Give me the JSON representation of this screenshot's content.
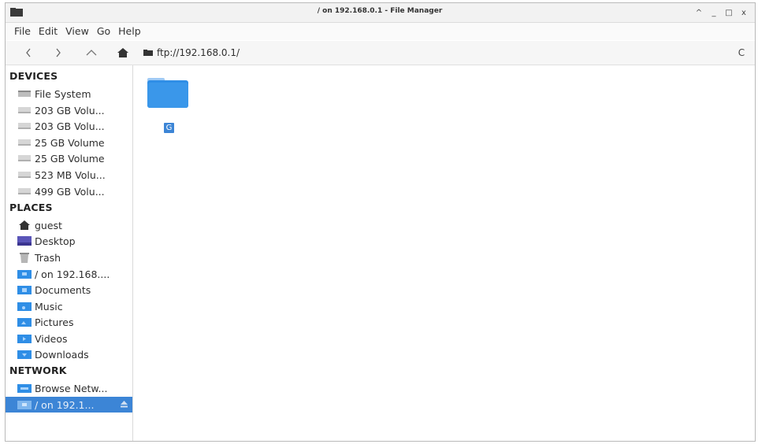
{
  "window": {
    "title": "/ on 192.168.0.1 - File Manager",
    "controls": {
      "collapse": "^",
      "minimize": "_",
      "maximize": "□",
      "close": "x"
    }
  },
  "menubar": {
    "items": [
      "File",
      "Edit",
      "View",
      "Go",
      "Help"
    ]
  },
  "toolbar": {
    "back_icon": "chevron-left-icon",
    "forward_icon": "chevron-right-icon",
    "up_icon": "chevron-up-icon",
    "home_icon": "home-icon",
    "location": "ftp://192.168.0.1/",
    "reload": "C"
  },
  "sidebar": {
    "devices_header": "DEVICES",
    "devices": [
      "File System",
      "203 GB Volu...",
      "203 GB Volu...",
      "25 GB Volume",
      "25 GB Volume",
      "523 MB Volu...",
      "499 GB Volu..."
    ],
    "places_header": "PLACES",
    "places": [
      "guest",
      "Desktop",
      "Trash",
      "/ on 192.168....",
      "Documents",
      "Music",
      "Pictures",
      "Videos",
      "Downloads"
    ],
    "network_header": "NETWORK",
    "network": [
      "Browse Netw...",
      "/ on 192.1..."
    ]
  },
  "content": {
    "items": [
      {
        "name": "G",
        "type": "folder"
      }
    ]
  },
  "colors": {
    "accent": "#3c85d6",
    "folder": "#2f8ee6",
    "titlebar": "#f2f2f2"
  }
}
